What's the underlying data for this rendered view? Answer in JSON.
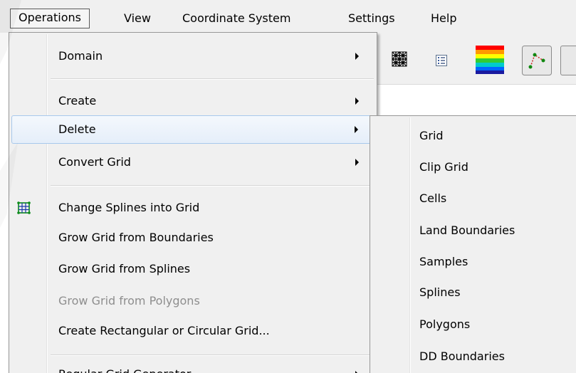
{
  "menubar": {
    "items": [
      {
        "label": "Operations"
      },
      {
        "label": "View"
      },
      {
        "label": "Coordinate System"
      },
      {
        "label": "Settings"
      },
      {
        "label": "Help"
      }
    ]
  },
  "toolbar": {
    "icons": [
      "grid-pattern-icon",
      "properties-list-icon",
      "color-scale-icon",
      "spline-edit-icon"
    ]
  },
  "operations_menu": {
    "items": [
      {
        "label": "Domain",
        "submenu": true
      },
      {
        "label": "Create",
        "submenu": true
      },
      {
        "label": "Delete",
        "submenu": true,
        "highlighted": true
      },
      {
        "label": "Convert Grid",
        "submenu": true
      },
      {
        "label": "Change Splines into Grid",
        "icon": "grid-icon"
      },
      {
        "label": "Grow Grid from Boundaries"
      },
      {
        "label": "Grow Grid from Splines"
      },
      {
        "label": "Grow Grid from Polygons",
        "disabled": true
      },
      {
        "label": "Create Rectangular or Circular Grid..."
      },
      {
        "label": "Regular Grid Generator",
        "submenu": true
      }
    ]
  },
  "delete_submenu": {
    "items": [
      {
        "label": "Grid"
      },
      {
        "label": "Clip Grid"
      },
      {
        "label": "Cells"
      },
      {
        "label": "Land Boundaries"
      },
      {
        "label": "Samples"
      },
      {
        "label": "Splines"
      },
      {
        "label": "Polygons"
      },
      {
        "label": "DD Boundaries"
      }
    ]
  },
  "colors": {
    "menu_background": "#f0f0f0",
    "highlight_border": "#a8c8ec",
    "disabled_text": "#8e8e8e",
    "grid_icon": "#0a8a1a"
  }
}
